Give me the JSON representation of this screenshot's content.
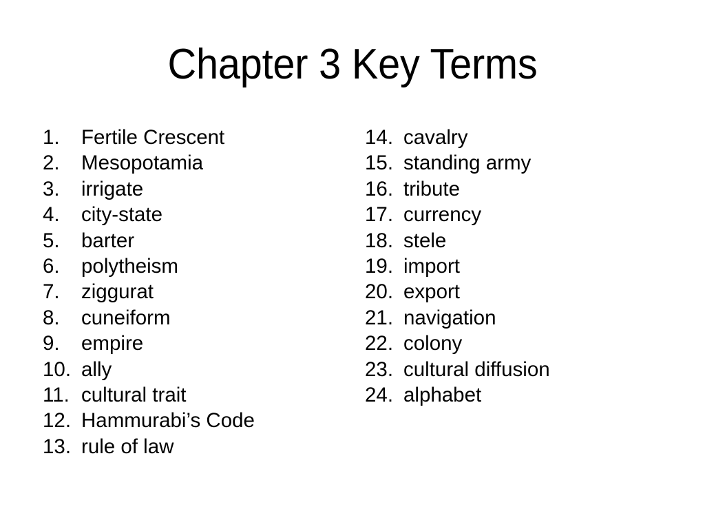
{
  "slide": {
    "title": "Chapter 3 Key Terms",
    "background_color": "#FFFFFF",
    "text_color": "#000000"
  },
  "terms": {
    "left_column": [
      {
        "number": "1.",
        "label": "Fertile Crescent"
      },
      {
        "number": "2.",
        "label": "Mesopotamia"
      },
      {
        "number": "3.",
        "label": "irrigate"
      },
      {
        "number": "4.",
        "label": "city-state"
      },
      {
        "number": "5.",
        "label": "barter"
      },
      {
        "number": "6.",
        "label": "polytheism"
      },
      {
        "number": "7.",
        "label": "ziggurat"
      },
      {
        "number": "8.",
        "label": "cuneiform"
      },
      {
        "number": "9.",
        "label": "empire"
      },
      {
        "number": "10.",
        "label": "ally"
      },
      {
        "number": "11.",
        "label": "cultural trait"
      },
      {
        "number": "12.",
        "label": "Hammurabi’s Code"
      },
      {
        "number": "13.",
        "label": "rule of law"
      }
    ],
    "right_column": [
      {
        "number": "14.",
        "label": "cavalry"
      },
      {
        "number": "15.",
        "label": "standing army"
      },
      {
        "number": "16.",
        "label": "tribute"
      },
      {
        "number": "17.",
        "label": "currency"
      },
      {
        "number": "18.",
        "label": "stele"
      },
      {
        "number": "19.",
        "label": "import"
      },
      {
        "number": "20.",
        "label": "export"
      },
      {
        "number": "21.",
        "label": "navigation"
      },
      {
        "number": "22.",
        "label": "colony"
      },
      {
        "number": "23.",
        "label": "cultural diffusion"
      },
      {
        "number": "24.",
        "label": "alphabet"
      }
    ]
  }
}
